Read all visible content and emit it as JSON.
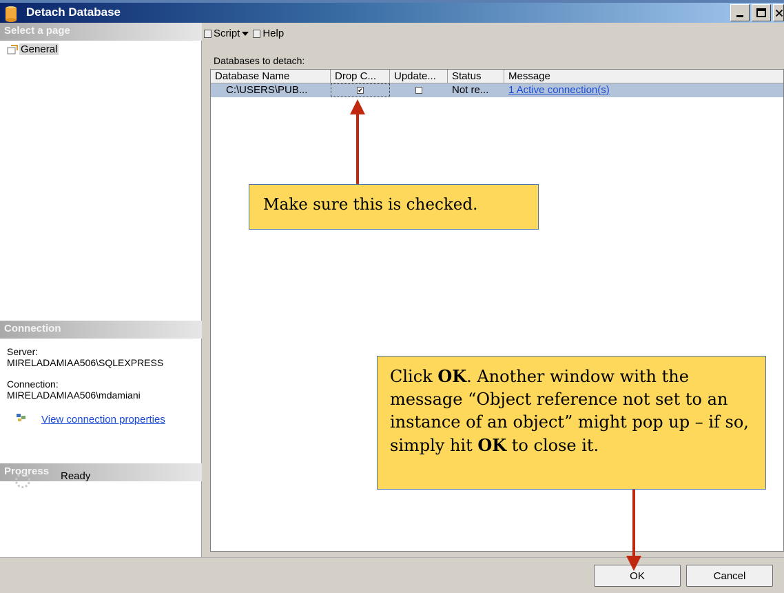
{
  "window": {
    "title": "Detach Database"
  },
  "left": {
    "select_page_header": "Select a page",
    "pages": [
      {
        "label": "General"
      }
    ],
    "connection_header": "Connection",
    "server_label": "Server:",
    "server_value": "MIRELADAMIAA506\\SQLEXPRESS",
    "connection_label": "Connection:",
    "connection_value": "MIRELADAMIAA506\\mdamiani",
    "view_props_link": "View connection properties",
    "progress_header": "Progress",
    "progress_status": "Ready"
  },
  "toolbar": {
    "script_label": "Script",
    "help_label": "Help"
  },
  "main": {
    "section_label": "Databases to detach:",
    "columns": [
      "Database Name",
      "Drop C...",
      "Update...",
      "Status",
      "Message"
    ],
    "rows": [
      {
        "database_name": "C:\\USERS\\PUB...",
        "drop_connections": true,
        "update_statistics": false,
        "status": "Not re...",
        "message": "1 Active connection(s)"
      }
    ]
  },
  "buttons": {
    "ok": "OK",
    "cancel": "Cancel"
  },
  "callouts": {
    "checkbox_note": "Make sure this is checked.",
    "ok_note": {
      "p1": "Click ",
      "b1": "OK",
      "p2": ".  Another window with the message “Object reference not set to an instance of an object” might pop up – if so, simply hit ",
      "b2": "OK",
      "p3": " to close it."
    }
  },
  "colors": {
    "callout_fill": "#fdd85a",
    "arrow": "#c0290f",
    "selected_row": "#b3c3d9",
    "link": "#1a4bd6"
  }
}
